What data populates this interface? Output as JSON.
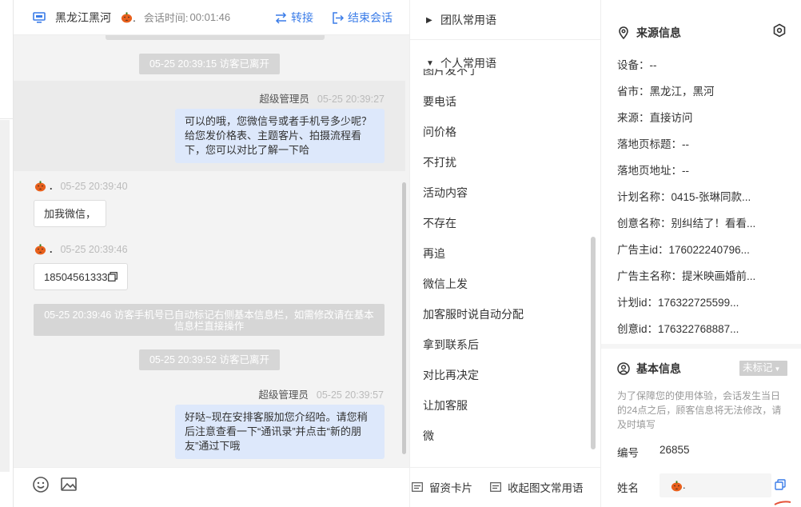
{
  "header": {
    "region": "黑龙江黑河",
    "visitor_suffix": ".",
    "time_label": "会话时间:",
    "time_value": "00:01:46",
    "transfer": "转接",
    "end_session": "结束会话"
  },
  "messages": {
    "sys1": "05-25 20:39:15 访客已离开",
    "agent1": {
      "name": "超级管理员",
      "ts": "05-25 20:39:27",
      "text": "可以的哦，您微信号或者手机号多少呢？给您发价格表、主题客片、拍摄流程看下，您可以对比了解一下哈"
    },
    "visitor1": {
      "ts": "05-25 20:39:40",
      "text": "加我微信，"
    },
    "visitor2": {
      "ts": "05-25 20:39:46",
      "text": "18504561333"
    },
    "sys2": "05-25 20:39:46 访客手机号已自动标记右侧基本信息栏，如需修改请在基本信息栏直接操作",
    "sys3": "05-25 20:39:52 访客已离开",
    "agent2": {
      "name": "超级管理员",
      "ts": "05-25 20:39:57",
      "text": "好哒~现在安排客服加您介绍哈。请您稍后注意查看一下“通讯录”并点击“新的朋友”通过下哦"
    }
  },
  "phrases": {
    "team_group": "团队常用语",
    "personal_group": "个人常用语",
    "clipped_item": "图片发不了",
    "items": [
      "要电话",
      "问价格",
      "不打扰",
      "活动内容",
      "不存在",
      "再追",
      "微信上发",
      "加客服时说自动分配",
      "拿到联系后",
      "对比再决定",
      "让加客服",
      "微"
    ],
    "card_btn": "留资卡片",
    "collapse_btn": "收起图文常用语"
  },
  "info": {
    "source_title": "来源信息",
    "source_rows": [
      "设备：--",
      "省市：黑龙江，黑河",
      "来源：直接访问",
      "落地页标题：--",
      "落地页地址：--",
      "计划名称：0415-张琳同款...",
      "创意名称：别纠结了！看看...",
      "广告主id：176022240796...",
      "广告主名称：提米映画婚前...",
      "计划id：176322725599...",
      "创意id：176322768887..."
    ],
    "basic_title": "基本信息",
    "tag_badge": "未标记",
    "note": "为了保障您的使用体验，会话发生当日的24点之后，顾客信息将无法修改，请及时填写",
    "id_label": "编号",
    "id_value": "26855",
    "name_label": "姓名",
    "name_value": "."
  }
}
